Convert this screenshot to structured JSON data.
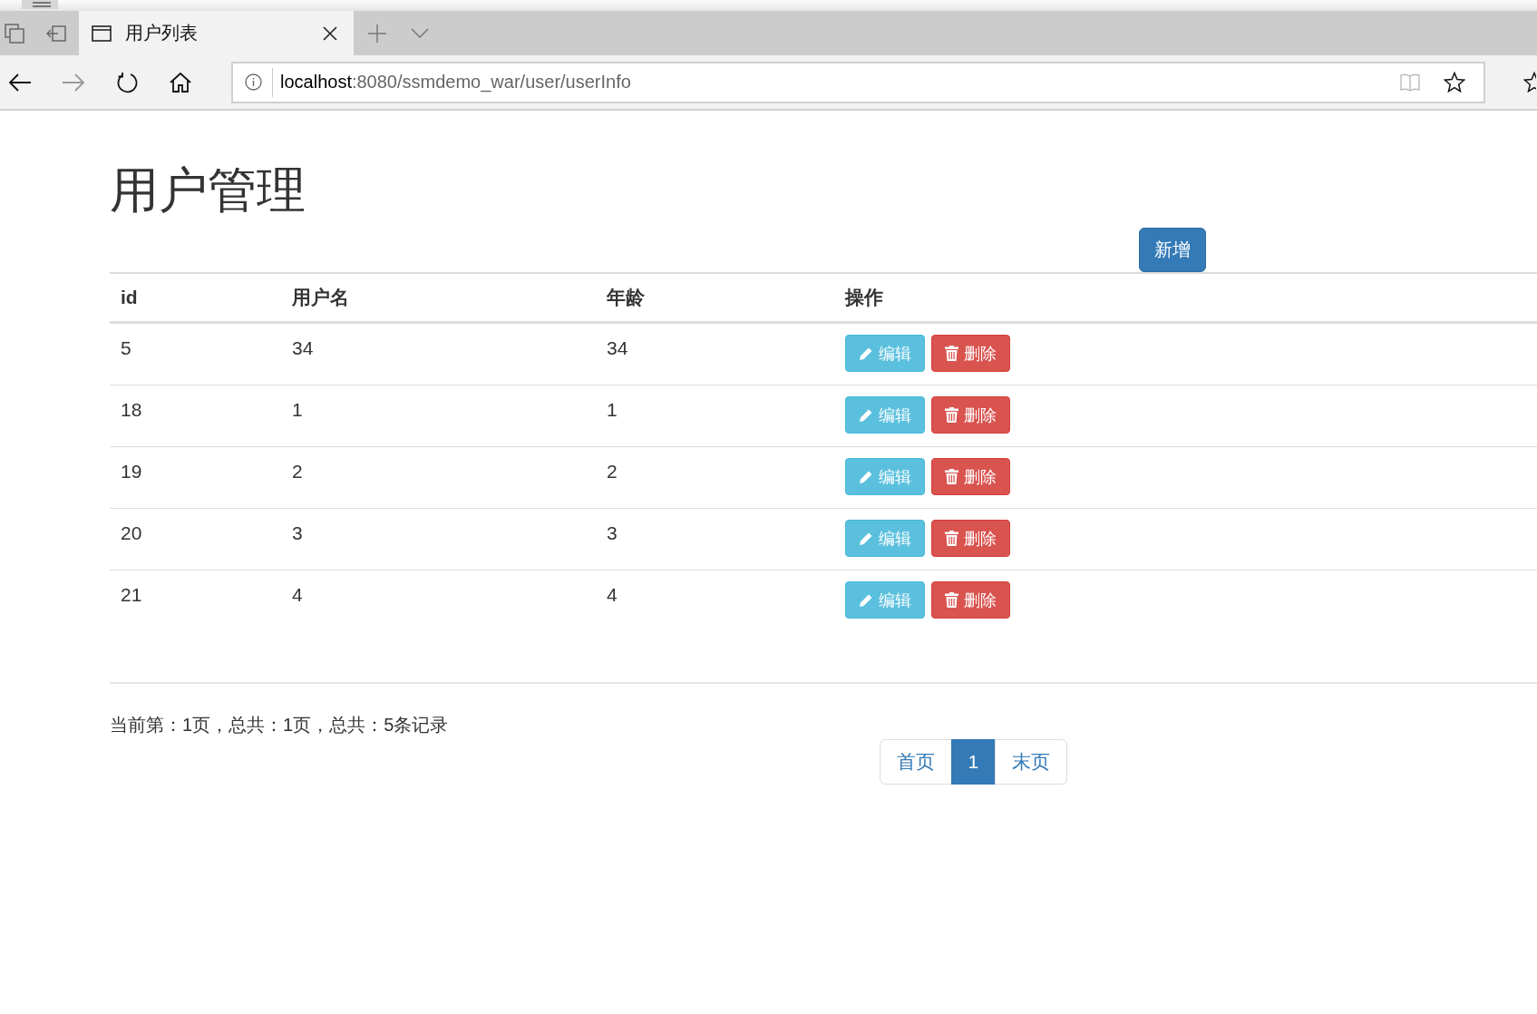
{
  "browser": {
    "tabs": [
      {
        "title": "用户列表",
        "selected": true
      }
    ],
    "nav": [
      {
        "kind": "back",
        "disabled": false
      },
      {
        "kind": "forward",
        "disabled": true
      },
      {
        "kind": "refresh",
        "disabled": false
      },
      {
        "kind": "home",
        "disabled": false
      }
    ],
    "address": {
      "host": "localhost",
      "path": ":8080/ssmdemo_war/user/userInfo"
    }
  },
  "page": {
    "title": "用户管理",
    "add_button": "新增"
  },
  "table": {
    "columns": [
      "id",
      "用户名",
      "年龄",
      "操作"
    ],
    "rows": [
      {
        "id": "5",
        "username": "34",
        "age": "34",
        "actions": [
          {
            "kind": "edit",
            "label": "编辑"
          },
          {
            "kind": "delete",
            "label": "删除"
          }
        ]
      },
      {
        "id": "18",
        "username": "1",
        "age": "1",
        "actions": [
          {
            "kind": "edit",
            "label": "编辑"
          },
          {
            "kind": "delete",
            "label": "删除"
          }
        ]
      },
      {
        "id": "19",
        "username": "2",
        "age": "2",
        "actions": [
          {
            "kind": "edit",
            "label": "编辑"
          },
          {
            "kind": "delete",
            "label": "删除"
          }
        ]
      },
      {
        "id": "20",
        "username": "3",
        "age": "3",
        "actions": [
          {
            "kind": "edit",
            "label": "编辑"
          },
          {
            "kind": "delete",
            "label": "删除"
          }
        ]
      },
      {
        "id": "21",
        "username": "4",
        "age": "4",
        "actions": [
          {
            "kind": "edit",
            "label": "编辑"
          },
          {
            "kind": "delete",
            "label": "删除"
          }
        ]
      }
    ]
  },
  "footer": {
    "summary": "当前第：1页，总共：1页，总共：5条记录",
    "pagination": [
      {
        "label": "首页",
        "selected": false
      },
      {
        "label": "1",
        "selected": true
      },
      {
        "label": "末页",
        "selected": false
      }
    ]
  }
}
